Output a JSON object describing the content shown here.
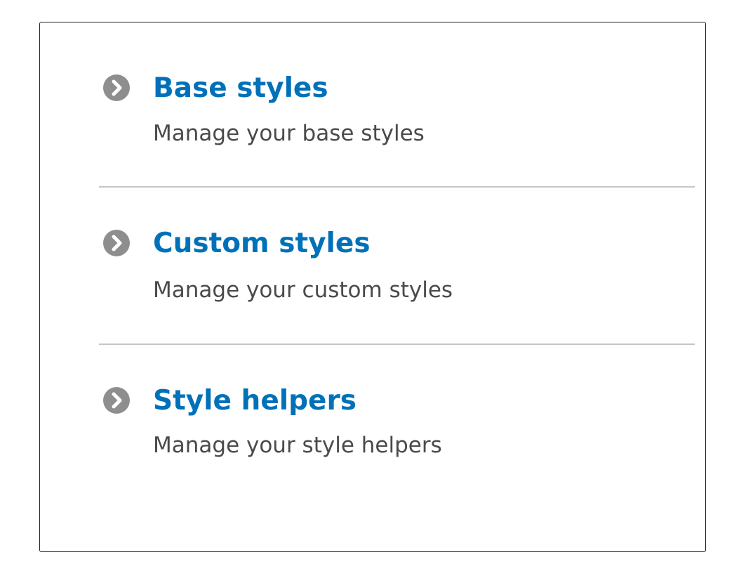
{
  "items": [
    {
      "title": "Base styles",
      "description": "Manage your base styles",
      "icon": "chevron-right-circle-icon"
    },
    {
      "title": "Custom styles",
      "description": "Manage your custom styles",
      "icon": "chevron-right-circle-icon"
    },
    {
      "title": "Style helpers",
      "description": "Manage your style helpers",
      "icon": "chevron-right-circle-icon"
    }
  ],
  "colors": {
    "link": "#0071b9",
    "description": "#4a4a4a",
    "icon": "#8e8e8e",
    "divider": "#c6c6c6"
  }
}
